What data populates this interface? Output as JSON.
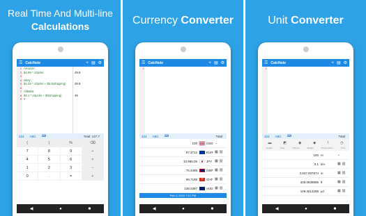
{
  "panels": [
    {
      "headline_line1": "Real Time And Multi-line",
      "headline_line2": "Calculations"
    },
    {
      "headline_plain": "Currency ",
      "headline_bold": "Converter"
    },
    {
      "headline_plain": "Unit ",
      "headline_bold": "Converter"
    }
  ],
  "app": {
    "title": "CalcNote"
  },
  "calc": {
    "gutter": [
      "1",
      "2",
      "3",
      "4",
      "5",
      "6",
      "7",
      "8",
      "9"
    ],
    "lines": [
      "Amazon",
      "$4.99 * 10pcks",
      "",
      "eBay",
      "$4.29 * 10pcks + $5.9(shipping)",
      "",
      "Alibaba",
      "$4.1 * 10pcks + $8(shipping)",
      "#"
    ],
    "results": [
      "",
      "49.9",
      "",
      "",
      "48.8",
      "",
      "",
      "49",
      ""
    ],
    "tabs": [
      "123",
      "ABC",
      "⌨"
    ],
    "total_label": "Total:",
    "total_value": "147.7",
    "keys": [
      "(",
      ")",
      "%",
      "⌫",
      "7",
      "8",
      "9",
      "÷",
      "4",
      "5",
      "6",
      "×",
      "1",
      "2",
      "3",
      "−",
      "0",
      ".",
      "=",
      "+"
    ]
  },
  "currency": {
    "tabs": [
      "123",
      "ABC",
      "⌨"
    ],
    "total_label": "Total",
    "rows": [
      {
        "value": "100",
        "code": "USD",
        "flag_color": "#b22234"
      },
      {
        "value": "87.3712",
        "code": "EUR",
        "flag_color": "#003399"
      },
      {
        "value": "10,988.05",
        "code": "JPY",
        "flag_color": "#ffffff"
      },
      {
        "value": "76.3498",
        "code": "GBP",
        "flag_color": "#c8102e"
      },
      {
        "value": "99.7196",
        "code": "CHF",
        "flag_color": "#d52b1e"
      },
      {
        "value": "138.3397",
        "code": "AUD",
        "flag_color": "#012169"
      }
    ],
    "date": "Feb 4, 2019 7:07 PM"
  },
  "unit": {
    "tabs": [
      "123",
      "ABC",
      "⌨"
    ],
    "total_label": "Total",
    "categories": [
      "Length",
      "Area",
      "Volume",
      "Weight",
      "Temperature",
      "Time"
    ],
    "rows": [
      {
        "value": "100",
        "unit": "m"
      },
      {
        "value": "0.1",
        "unit": "km"
      },
      {
        "value": "3,937.007874",
        "unit": "in"
      },
      {
        "value": "328.0839895",
        "unit": "ft"
      },
      {
        "value": "109.3613298",
        "unit": "yd"
      }
    ]
  },
  "colors": {
    "background": "#2ea2e6",
    "appbar": "#1e88e5",
    "navbar": "#222222"
  }
}
